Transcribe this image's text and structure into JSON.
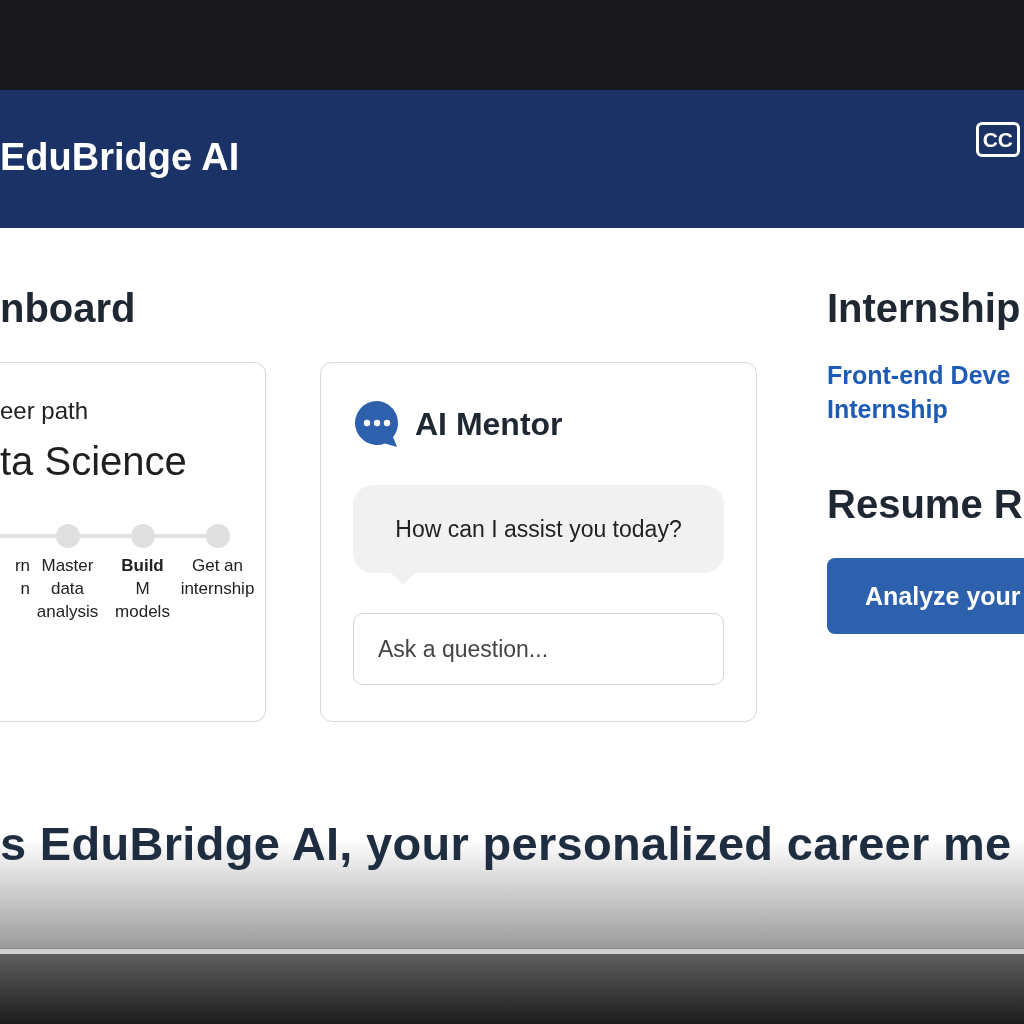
{
  "header": {
    "title": "EduBridge AI",
    "cc_label": "CC"
  },
  "dashboard": {
    "heading": "nboard",
    "career_card": {
      "label": "eer path",
      "title": "ta Science",
      "steps": [
        {
          "kind": "partial",
          "label": "rn\nn"
        },
        {
          "kind": "step",
          "label": "Master\ndata\nanalysis"
        },
        {
          "kind": "step",
          "label": "**Build**\nM\nmodels"
        },
        {
          "kind": "step",
          "label": "Get an\ninternship"
        }
      ]
    },
    "mentor_card": {
      "title": "AI Mentor",
      "message": "How can I assist you today?",
      "input": {
        "placeholder": "Ask a question..."
      }
    }
  },
  "side": {
    "internships_heading": "Internship",
    "internship_link": "Front-end Deve\nInternship",
    "resume_heading": "Resume R",
    "analyze_button": "Analyze your"
  },
  "caption": "s EduBridge AI, your personalized career me"
}
